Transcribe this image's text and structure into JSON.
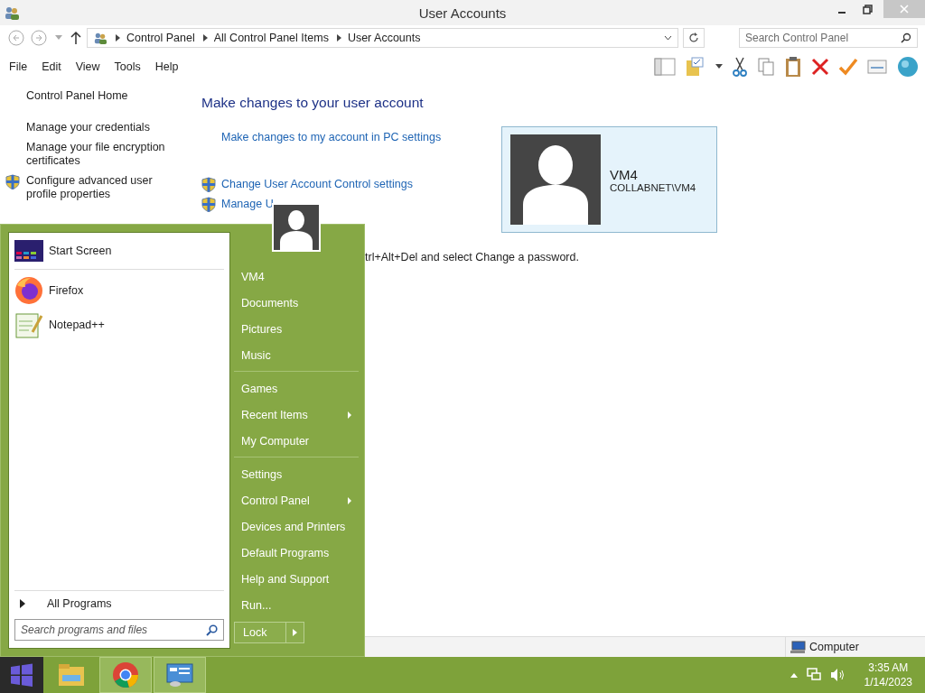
{
  "window": {
    "title": "User Accounts"
  },
  "address_bar": {
    "breadcrumbs": [
      "Control Panel",
      "All Control Panel Items",
      "User Accounts"
    ]
  },
  "search": {
    "placeholder": "Search Control Panel"
  },
  "menu_bar": [
    "File",
    "Edit",
    "View",
    "Tools",
    "Help"
  ],
  "sidebar": {
    "home": "Control Panel Home",
    "items": [
      {
        "label": "Manage your credentials",
        "shield": false
      },
      {
        "label": "Manage your file encryption certificates",
        "shield": false
      },
      {
        "label": "Configure advanced user profile properties",
        "shield": true
      }
    ]
  },
  "main": {
    "heading": "Make changes to your user account",
    "links": [
      {
        "label": "Make changes to my account in PC settings",
        "shield": false
      },
      {
        "label": "Change User Account Control settings",
        "shield": true
      },
      {
        "label": "Manage U",
        "shield": true
      }
    ],
    "note": "trl+Alt+Del and select Change a password."
  },
  "account": {
    "name": "VM4",
    "domain": "COLLABNET\\VM4"
  },
  "status_bar": {
    "label": "Computer"
  },
  "start_menu": {
    "pinned": [
      {
        "label": "Start Screen",
        "kind": "start"
      },
      {
        "label": "Firefox",
        "kind": "firefox"
      },
      {
        "label": "Notepad++",
        "kind": "notepad"
      }
    ],
    "all_programs": "All Programs",
    "search": {
      "placeholder": "Search programs and files"
    },
    "places": [
      {
        "items": [
          {
            "label": "VM4",
            "submenu": false
          },
          {
            "label": "Documents",
            "submenu": false
          },
          {
            "label": "Pictures",
            "submenu": false
          },
          {
            "label": "Music",
            "submenu": false
          }
        ]
      },
      {
        "items": [
          {
            "label": "Games",
            "submenu": false
          },
          {
            "label": "Recent Items",
            "submenu": true
          },
          {
            "label": "My Computer",
            "submenu": false
          }
        ]
      },
      {
        "items": [
          {
            "label": "Settings",
            "submenu": false
          },
          {
            "label": "Control Panel",
            "submenu": true
          },
          {
            "label": "Devices and Printers",
            "submenu": false
          },
          {
            "label": "Default Programs",
            "submenu": false
          },
          {
            "label": "Help and Support",
            "submenu": false
          },
          {
            "label": "Run...",
            "submenu": false
          }
        ]
      }
    ],
    "lock": "Lock"
  },
  "taskbar": {
    "apps": [
      {
        "kind": "explorer",
        "selected": false
      },
      {
        "kind": "chrome",
        "selected": true
      },
      {
        "kind": "control-panel",
        "selected": true
      }
    ],
    "time": "3:35 AM",
    "date": "1/14/2023"
  }
}
